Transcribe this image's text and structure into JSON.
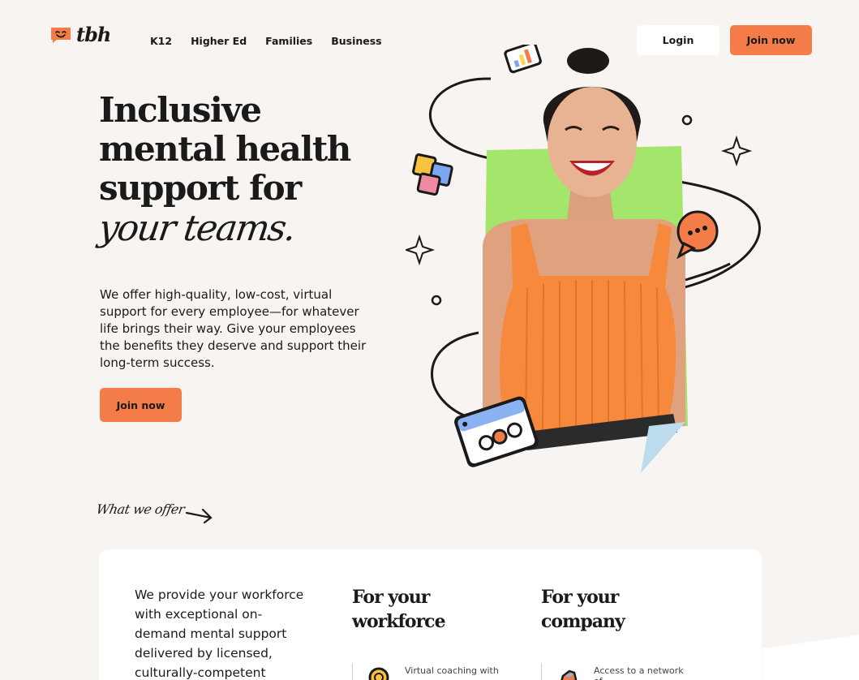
{
  "brand": {
    "name": "tbh",
    "accent": "#f47c48",
    "background": "#f8f4f1"
  },
  "nav": {
    "items": [
      {
        "label": "K12"
      },
      {
        "label": "Higher Ed"
      },
      {
        "label": "Families"
      },
      {
        "label": "Business"
      }
    ],
    "login_label": "Login",
    "join_label": "Join now"
  },
  "hero": {
    "title_lines": [
      "Inclusive",
      "mental health",
      "support for"
    ],
    "title_script": "your teams.",
    "description": "We offer high-quality, low-cost, virtual support for every employee—for whatever life brings their way. Give your employees the benefits they deserve and support their long-term success.",
    "cta_label": "Join now"
  },
  "offer": {
    "section_label": "What we offer",
    "intro": "We provide your workforce with exceptional on-demand mental support delivered by licensed, culturally-competent",
    "columns": [
      {
        "title": "For your workforce",
        "item_text": "Virtual coaching with",
        "icon": "coin-icon"
      },
      {
        "title": "For your company",
        "item_text": "Access to a network of",
        "icon": "hand-icon"
      }
    ]
  }
}
